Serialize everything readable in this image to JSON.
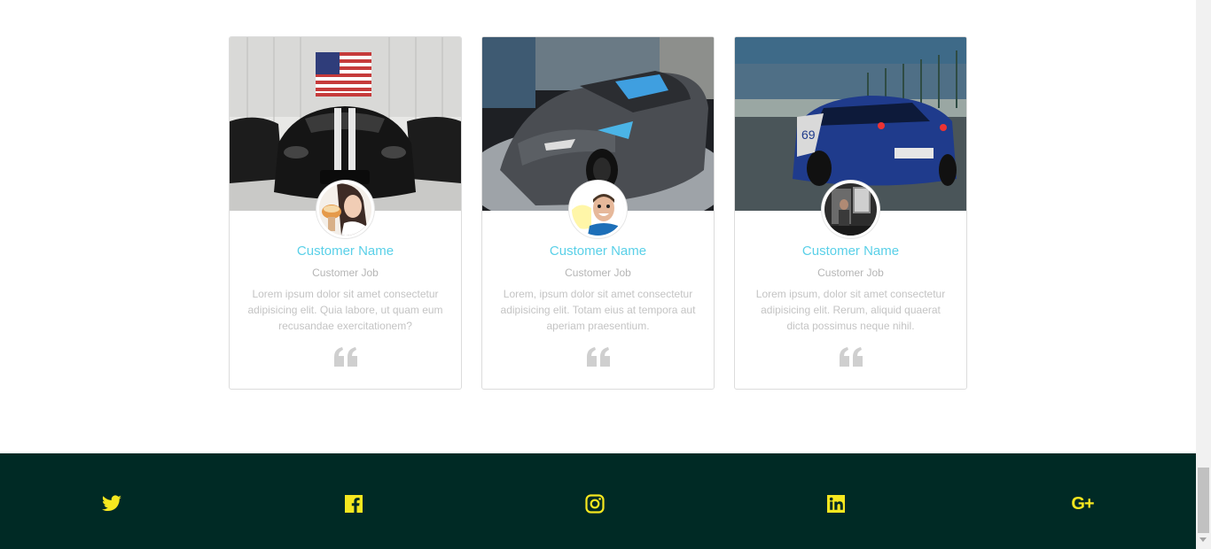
{
  "testimonials": [
    {
      "name": "Customer Name",
      "job": "Customer Job",
      "text": "Lorem ipsum dolor sit amet consectetur adipisicing elit. Quia labore, ut quam eum recusandae exercitationem?",
      "photo": "black-car-in-hangar-with-flag",
      "avatar": "woman-eating-cake"
    },
    {
      "name": "Customer Name",
      "job": "Customer Job",
      "text": "Lorem, ipsum dolor sit amet consectetur adipisicing elit. Totam eius at tempora aut aperiam praesentium.",
      "photo": "grey-corvette-in-showroom",
      "avatar": "smiling-man"
    },
    {
      "name": "Customer Name",
      "job": "Customer Job",
      "text": "Lorem ipsum, dolor sit amet consectetur adipisicing elit. Rerum, aliquid quaerat dicta possimus neque nihil.",
      "photo": "blue-race-car-on-track",
      "avatar": "person-in-doorway"
    }
  ],
  "footer": {
    "background": "#002a25",
    "icon_color": "#f6e71f",
    "social": [
      {
        "icon": "twitter-icon"
      },
      {
        "icon": "facebook-icon"
      },
      {
        "icon": "instagram-icon"
      },
      {
        "icon": "linkedin-icon"
      },
      {
        "icon": "google-plus-icon",
        "label": "G+"
      }
    ]
  },
  "colors": {
    "accent": "#5ad0e8",
    "muted_text": "#c4c4c4",
    "quote_icon": "#cfcfcf"
  }
}
